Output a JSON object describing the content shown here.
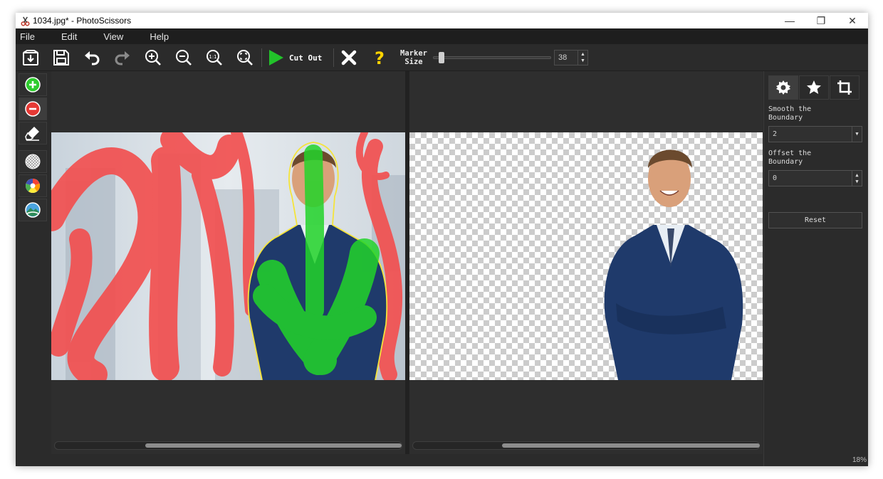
{
  "window": {
    "title": "1034.jpg* - PhotoScissors",
    "controls": [
      "—",
      "❐",
      "✕"
    ]
  },
  "menu": [
    "File",
    "Edit",
    "View",
    "Help"
  ],
  "toolbar": {
    "icons": [
      "open-icon",
      "save-icon",
      "undo-icon",
      "redo-icon",
      "zoom-in-icon",
      "zoom-out-icon",
      "zoom-actual-icon",
      "zoom-fit-icon"
    ],
    "zoom_actual_label": "1:1",
    "cut_out_label": "Cut Out",
    "marker_size_label": "Marker\nSize",
    "marker_size_value": "38",
    "marker_size_fraction": 0.05
  },
  "left_tools": [
    "mark-foreground-icon",
    "mark-background-icon",
    "eraser-icon",
    "transparent-background-icon",
    "color-background-icon",
    "image-background-icon"
  ],
  "right_panel": {
    "tabs": [
      "settings-icon",
      "effects-icon",
      "crop-icon"
    ],
    "smooth_label": "Smooth the\nBoundary",
    "smooth_value": "2",
    "offset_label": "Offset the\nBoundary",
    "offset_value": "0",
    "reset_label": "Reset"
  },
  "status": {
    "zoom": "18%"
  },
  "colors": {
    "foreground_mark": "#22d42a",
    "background_mark": "#f25050",
    "boundary": "#f5e43a",
    "accent_play": "#22c22a",
    "help": "#ffd400"
  }
}
